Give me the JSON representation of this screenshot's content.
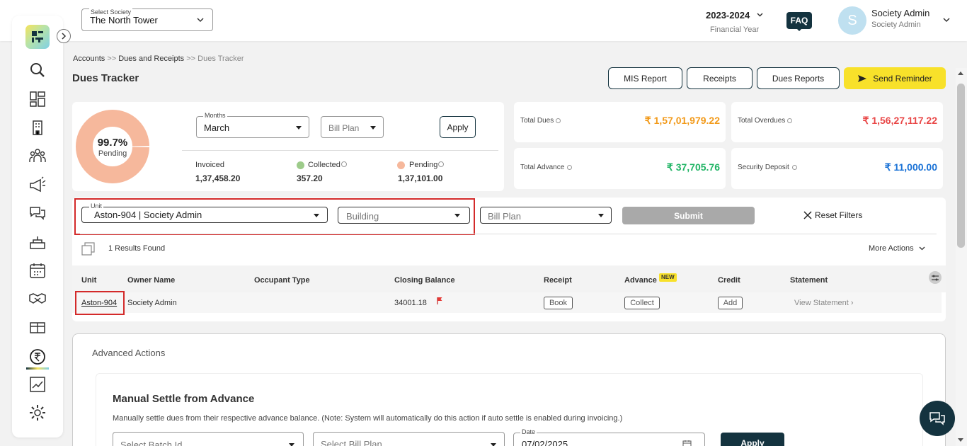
{
  "header": {
    "society_label": "Select Society",
    "society_value": "The North Tower",
    "financial_year": "2023-2024",
    "financial_year_label": "Financial Year",
    "faq": "FAQ",
    "avatar_initial": "S",
    "user_name": "Society Admin",
    "user_role": "Society Admin"
  },
  "breadcrumb": {
    "item1": "Accounts",
    "sep": ">>",
    "item2": "Dues and Receipts",
    "item3": "Dues Tracker"
  },
  "page_title": "Dues Tracker",
  "actions": {
    "mis": "MIS Report",
    "receipts": "Receipts",
    "dues_reports": "Dues Reports",
    "send_reminder": "Send Reminder"
  },
  "summary": {
    "pending_percent": 99.7,
    "pending_percent_label": "99.7%",
    "pending_label": "Pending",
    "months_label": "Months",
    "months_value": "March",
    "bill_plan_placeholder": "Bill Plan",
    "apply": "Apply",
    "invoiced_label": "Invoiced",
    "invoiced_value": "1,37,458.20",
    "collected_label": "Collected",
    "collected_value": "357.20",
    "pending_amount_label": "Pending",
    "pending_value": "1,37,101.00",
    "colors": {
      "pending": "#f6b89c",
      "collected": "#9dcb8a"
    }
  },
  "stats": {
    "total_dues_label": "Total Dues",
    "total_dues": "₹ 1,57,01,979.22",
    "total_overdues_label": "Total Overdues",
    "total_overdues": "₹ 1,56,27,117.22",
    "total_advance_label": "Total Advance",
    "total_advance": "₹ 37,705.76",
    "security_deposit_label": "Security Deposit",
    "security_deposit": "₹ 11,000.00",
    "colors": {
      "dues": "#f29a1a",
      "overdues": "#e94747",
      "advance": "#1fb464",
      "deposit": "#1a72d6"
    }
  },
  "filters": {
    "unit_label": "Unit",
    "unit_value": "Aston-904 | Society Admin",
    "building_placeholder": "Building",
    "bill_plan_placeholder": "Bill Plan",
    "submit": "Submit",
    "reset": "Reset Filters",
    "results": "1 Results Found",
    "more_actions": "More Actions"
  },
  "table": {
    "columns": [
      "Unit",
      "Owner Name",
      "Occupant Type",
      "Closing Balance",
      "Receipt",
      "Advance",
      "Credit",
      "Statement"
    ],
    "new_badge": "NEW",
    "rows": [
      {
        "unit": "Aston-904",
        "owner": "Society Admin",
        "occupant": "",
        "closing_balance": "34001.18",
        "receipt": "Book",
        "advance": "Collect",
        "credit": "Add",
        "statement": "View Statement ›"
      }
    ]
  },
  "advanced": {
    "title": "Advanced Actions",
    "section_title": "Manual Settle from Advance",
    "description": "Manually settle dues from their respective advance balance. (Note: System will automatically do this action if auto settle is enabled during invoicing.)",
    "batch_placeholder": "Select Batch Id",
    "bill_plan_placeholder": "Select Bill Plan",
    "date_label": "Date",
    "date_value": "07/02/2025",
    "apply": "Apply"
  }
}
